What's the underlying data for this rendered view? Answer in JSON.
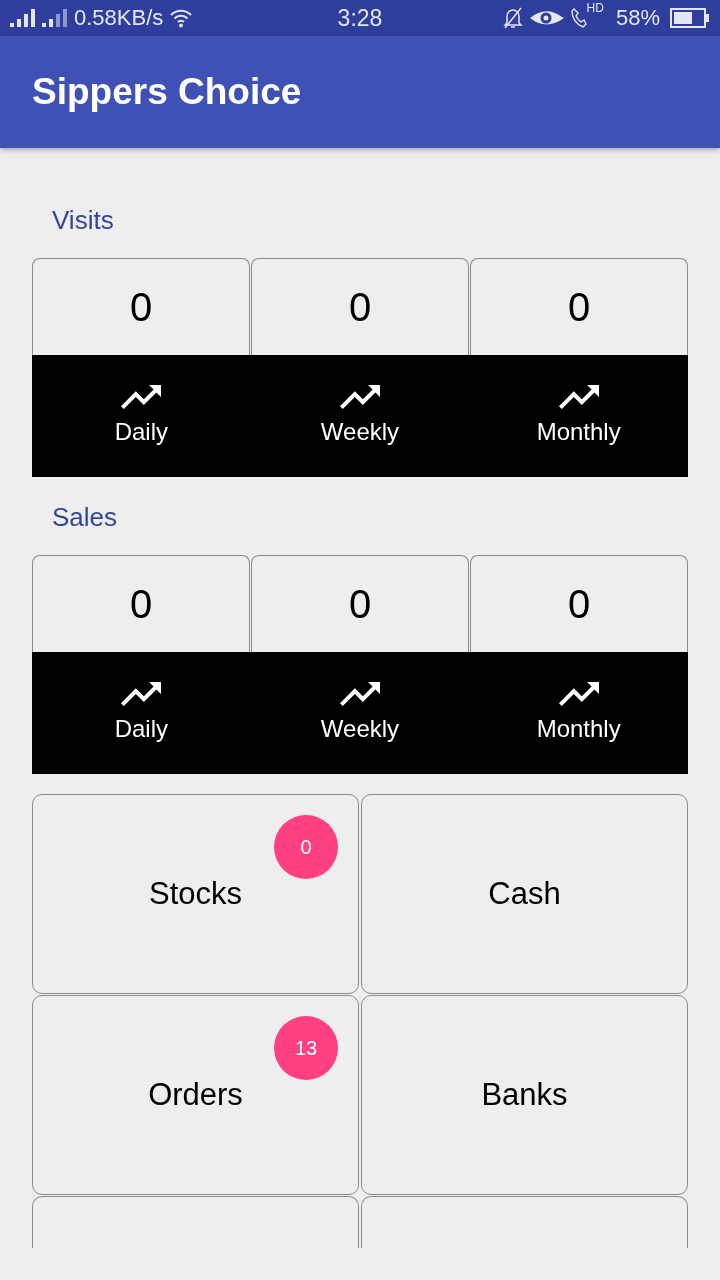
{
  "status_bar": {
    "network_speed": "0.58KB/s",
    "time": "3:28",
    "call_label": "HD",
    "battery": "58%"
  },
  "app_bar": {
    "title": "Sippers Choice"
  },
  "sections": [
    {
      "title": "Visits",
      "stats": [
        {
          "value": "0",
          "period": "Daily"
        },
        {
          "value": "0",
          "period": "Weekly"
        },
        {
          "value": "0",
          "period": "Monthly"
        }
      ]
    },
    {
      "title": "Sales",
      "stats": [
        {
          "value": "0",
          "period": "Daily"
        },
        {
          "value": "0",
          "period": "Weekly"
        },
        {
          "value": "0",
          "period": "Monthly"
        }
      ]
    }
  ],
  "tiles": [
    {
      "kind": "full",
      "label": "Stocks",
      "badge": "0"
    },
    {
      "kind": "full",
      "label": "Cash"
    },
    {
      "kind": "full",
      "label": "Orders",
      "badge": "13"
    },
    {
      "kind": "full",
      "label": "Banks"
    },
    {
      "kind": "cut"
    },
    {
      "kind": "cut"
    }
  ]
}
